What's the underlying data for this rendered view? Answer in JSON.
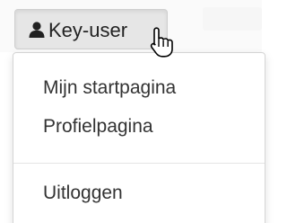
{
  "user_menu": {
    "button_label": "Key-user",
    "items": [
      {
        "label": "Mijn startpagina"
      },
      {
        "label": "Profielpagina"
      },
      {
        "label": "Uitloggen"
      }
    ]
  },
  "icons": {
    "user": "user-icon",
    "cursor": "hand-pointer-cursor-icon"
  },
  "colors": {
    "button_bg": "#e6e6e6",
    "text": "#333333",
    "divider": "#e5e5e5"
  }
}
